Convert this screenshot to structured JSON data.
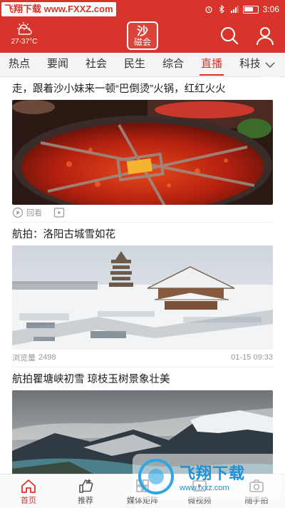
{
  "status_bar": {
    "watermark": "飞翔下载 www.FXXZ.com",
    "time": "3:06"
  },
  "header": {
    "weather_temp": "27-37°C",
    "logo_top": "沙",
    "logo_bottom": "磁会"
  },
  "tabs": [
    {
      "label": "热点"
    },
    {
      "label": "要闻"
    },
    {
      "label": "社会"
    },
    {
      "label": "民生"
    },
    {
      "label": "综合"
    },
    {
      "label": "直播"
    },
    {
      "label": "科技"
    }
  ],
  "active_tab": "直播",
  "feed": {
    "items": [
      {
        "title": "走，跟着沙小妹来一顿“巴倒烫”火锅，红红火火",
        "meta_label": "回看"
      },
      {
        "title": "航拍：洛阳古城雪如花",
        "views_label": "浏览量",
        "views": "2498",
        "date": "01-15 09:33"
      },
      {
        "title": "航拍瞿塘峡初雪 琼枝玉树景象壮美"
      }
    ]
  },
  "bottom_nav": [
    {
      "label": "首页"
    },
    {
      "label": "推荐"
    },
    {
      "label": "媒体矩阵"
    },
    {
      "label": "微视频"
    },
    {
      "label": "随手拍"
    }
  ],
  "watermark_br": {
    "cn": "飞翔下载",
    "url": "www.fxxz.com"
  },
  "colors": {
    "brand_red": "#d9342b",
    "watermark_blue": "#1f8fd6"
  }
}
